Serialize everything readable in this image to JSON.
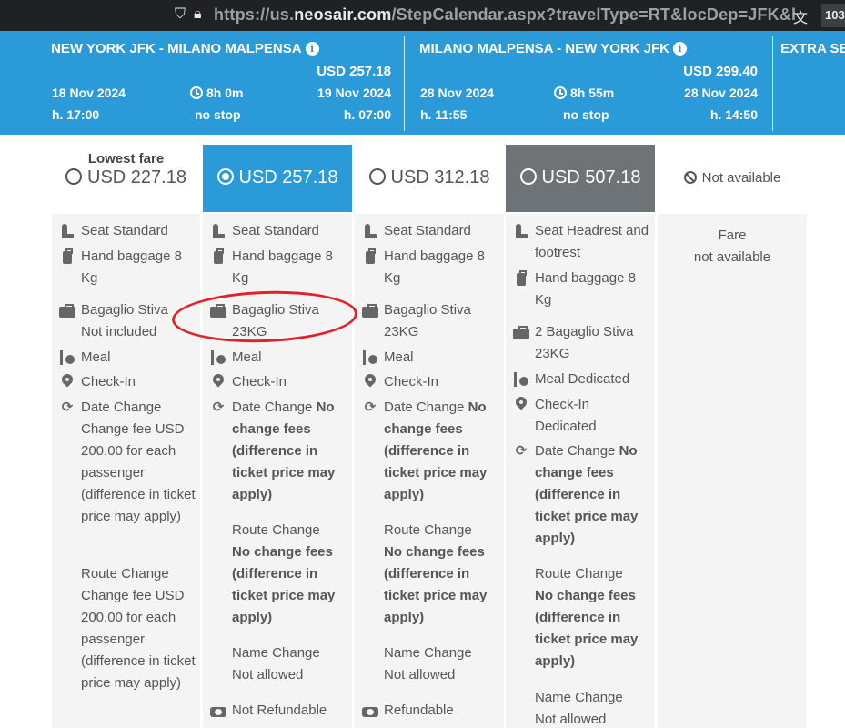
{
  "browser": {
    "url_prefix": "https://us.",
    "url_host": "neosair.com",
    "url_path": "/StepCalendar.aspx?travelType=RT&locDep=JFK&l",
    "badge": "103"
  },
  "legs": [
    {
      "route": "NEW YORK JFK - MILANO MALPENSA",
      "price": "USD 257.18",
      "dep_date": "18 Nov 2024",
      "dep_time": "h. 17:00",
      "duration": "8h 0m",
      "stops": "no stop",
      "arr_date": "19 Nov 2024",
      "arr_time": "h. 07:00"
    },
    {
      "route": "MILANO MALPENSA - NEW YORK JFK",
      "price": "USD 299.40",
      "dep_date": "28 Nov 2024",
      "dep_time": "h. 11:55",
      "duration": "8h 55m",
      "stops": "no stop",
      "arr_date": "28 Nov 2024",
      "arr_time": "h. 14:50"
    }
  ],
  "extra_label": "EXTRA SE",
  "fares": [
    {
      "lowest_label": "Lowest fare",
      "price": "USD 227.18",
      "selected": false
    },
    {
      "price": "USD 257.18",
      "selected": true
    },
    {
      "price": "USD 312.18",
      "selected": false
    },
    {
      "price": "USD 507.18",
      "selected": false
    },
    {
      "price": "Not available",
      "selected": false
    }
  ],
  "columns": [
    {
      "seat": "Seat Standard",
      "hand": "Hand baggage 8 Kg",
      "hold_1": "Bagaglio Stiva",
      "hold_2": "Not included",
      "meal": "Meal",
      "checkin": "Check-In",
      "date_change_label": "Date Change",
      "date_change_value": "Change fee USD 200.00 for each passenger (difference in ticket price may apply)",
      "route_change_label": "Route Change",
      "route_change_value": "Change fee USD 200.00 for each passenger (difference in ticket price may apply)"
    },
    {
      "seat": "Seat Standard",
      "hand": "Hand baggage 8 Kg",
      "hold_1": "Bagaglio Stiva",
      "hold_2": "23KG",
      "meal": "Meal",
      "checkin": "Check-In",
      "date_change_label": "Date Change",
      "date_change_value": "No change fees (difference in ticket price may apply)",
      "route_change_label": "Route Change",
      "route_change_value": "No change fees (difference in ticket price may apply)",
      "name_change_label": "Name Change",
      "name_change_value": "Not allowed",
      "refund": "Not Refundable"
    },
    {
      "seat": "Seat Standard",
      "hand": "Hand baggage 8 Kg",
      "hold_1": "Bagaglio Stiva",
      "hold_2": "23KG",
      "meal": "Meal",
      "checkin": "Check-In",
      "date_change_label": "Date Change",
      "date_change_value": "No change fees (difference in ticket price may apply)",
      "route_change_label": "Route Change",
      "route_change_value": "No change fees (difference in ticket price may apply)",
      "name_change_label": "Name Change",
      "name_change_value": "Not allowed",
      "refund": "Refundable"
    },
    {
      "seat": "Seat Headrest and footrest",
      "hand": "Hand baggage 8 Kg",
      "hold_1": "2 Bagaglio Stiva",
      "hold_2": "23KG",
      "meal": "Meal Dedicated",
      "checkin": "Check-In Dedicated",
      "date_change_label": "Date Change",
      "date_change_value": "No change fees (difference in ticket price may apply)",
      "route_change_label": "Route Change",
      "route_change_value": "No change fees (difference in ticket price may apply)",
      "name_change_label": "Name Change",
      "name_change_value": "Not allowed"
    },
    {
      "na_1": "Fare",
      "na_2": "not available"
    }
  ],
  "colors": {
    "header_blue": "#2a9bd8",
    "selected_fare": "#2a9bd8",
    "premium_fare": "#6e7378",
    "annotation_red": "#e0232b"
  }
}
